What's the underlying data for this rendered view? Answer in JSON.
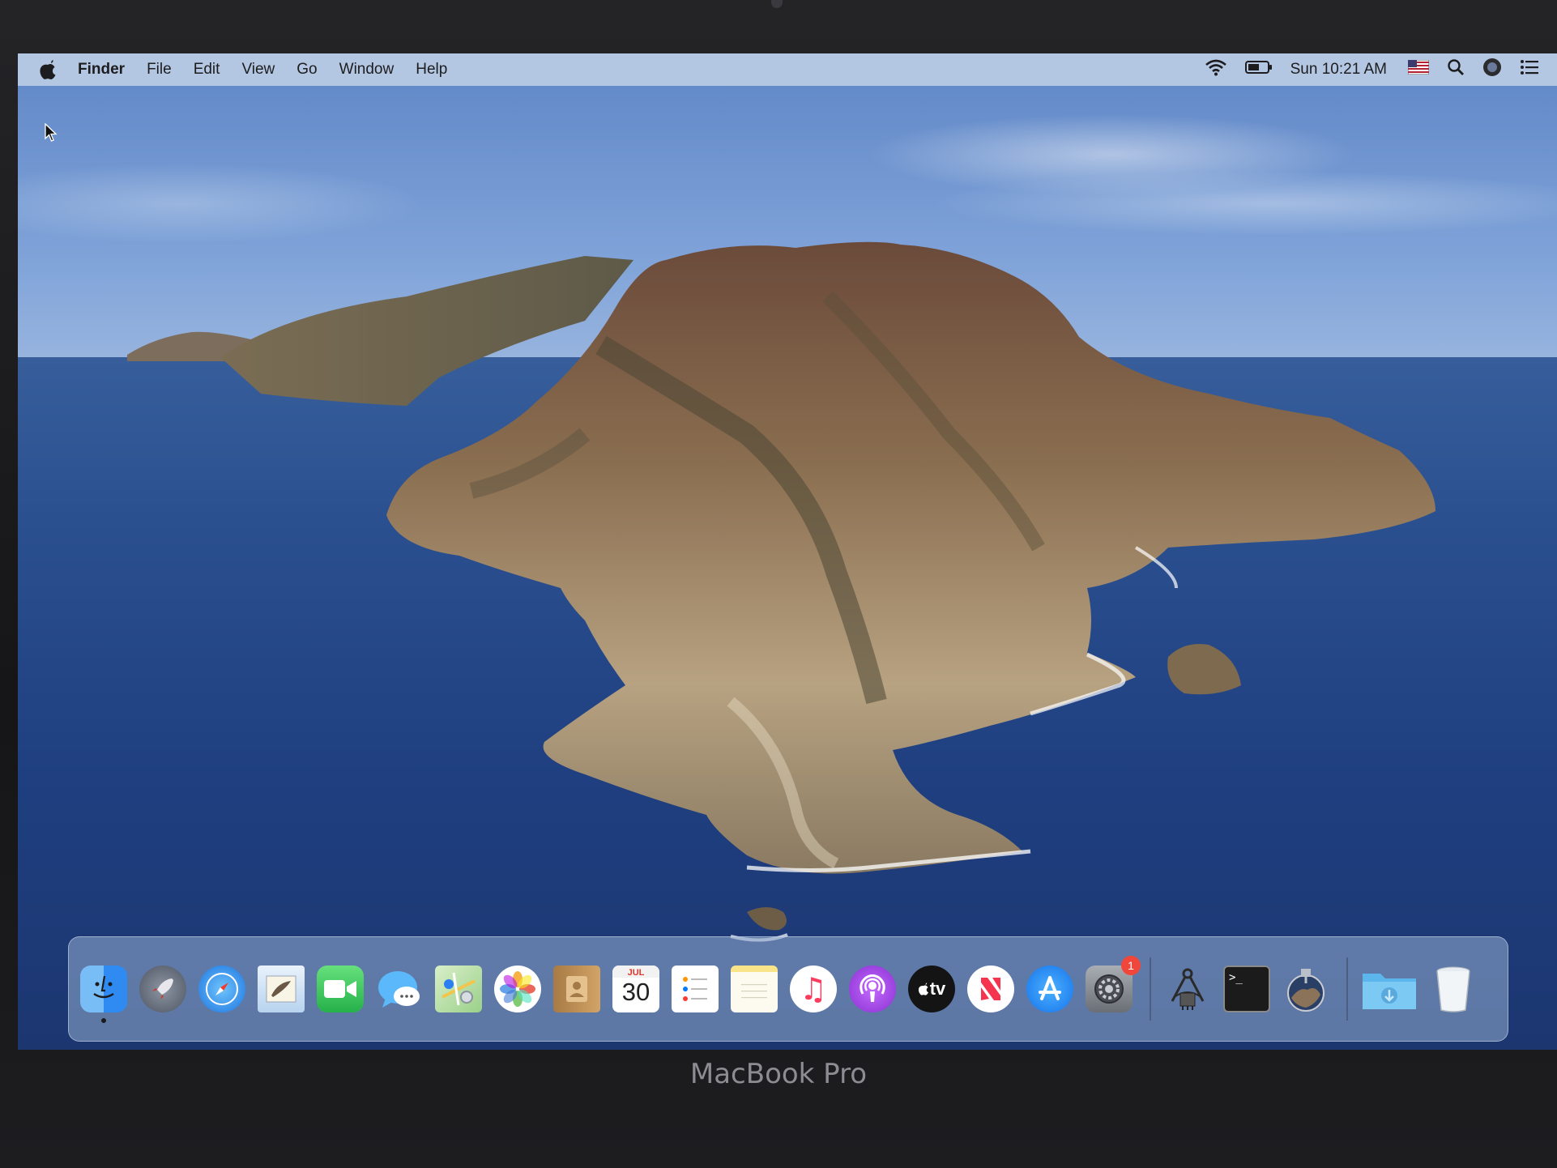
{
  "device": {
    "brand_label": "MacBook Pro"
  },
  "menubar": {
    "app_name": "Finder",
    "menus": [
      "File",
      "Edit",
      "View",
      "Go",
      "Window",
      "Help"
    ],
    "status_icons": [
      "wifi-icon",
      "battery-icon"
    ],
    "clock": "Sun 10:21 AM",
    "extras": [
      "us-flag-input-icon",
      "spotlight-search-icon",
      "siri-icon",
      "notification-center-icon"
    ]
  },
  "dock": {
    "apps": [
      {
        "name": "finder",
        "glyph": "",
        "bg": "#3c97f3",
        "running": true
      },
      {
        "name": "launchpad",
        "glyph": "🚀",
        "bg": "#5a6270"
      },
      {
        "name": "safari",
        "glyph": "",
        "bg": "#ffffff"
      },
      {
        "name": "mail",
        "glyph": "✉",
        "bg": "#d7e7f6"
      },
      {
        "name": "facetime",
        "glyph": "",
        "bg": "#3dc560"
      },
      {
        "name": "messages",
        "glyph": "💬",
        "bg": "#3ea3f5"
      },
      {
        "name": "maps",
        "glyph": "",
        "bg": "#8fd17a"
      },
      {
        "name": "photos",
        "glyph": "",
        "bg": "#ffffff"
      },
      {
        "name": "contacts",
        "glyph": "",
        "bg": "#c99a5c"
      },
      {
        "name": "calendar",
        "glyph": "",
        "bg": "#ffffff"
      },
      {
        "name": "reminders",
        "glyph": "",
        "bg": "#ffffff"
      },
      {
        "name": "notes",
        "glyph": "",
        "bg": "#fdfae8"
      },
      {
        "name": "music",
        "glyph": "♫",
        "bg": "#ffffff"
      },
      {
        "name": "podcasts",
        "glyph": "",
        "bg": "#a54de0"
      },
      {
        "name": "tv",
        "glyph": "",
        "bg": "#111111"
      },
      {
        "name": "news",
        "glyph": "N",
        "bg": "#ffffff"
      },
      {
        "name": "app-store",
        "glyph": "A",
        "bg": "#1e8cf1"
      },
      {
        "name": "system-preferences",
        "glyph": "⚙",
        "bg": "#8a8d93",
        "badge": "1"
      }
    ],
    "utilities": [
      {
        "name": "system-information",
        "glyph": "",
        "bg": "transparent"
      },
      {
        "name": "terminal",
        "glyph": ">_",
        "bg": "#1b1b1b"
      },
      {
        "name": "macos-catalina-installer",
        "glyph": "",
        "bg": "transparent"
      }
    ],
    "calendar_month": "JUL",
    "calendar_day": "30",
    "tv_label": "tv",
    "stacks": [
      {
        "name": "downloads-folder"
      },
      {
        "name": "trash"
      }
    ]
  }
}
